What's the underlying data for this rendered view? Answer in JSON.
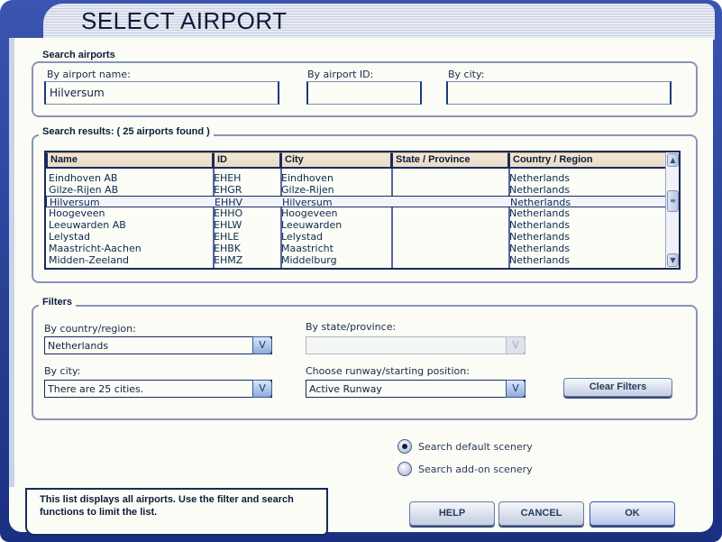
{
  "title": "SELECT AIRPORT",
  "search": {
    "group_label": "Search airports",
    "name_label": "By airport name:",
    "name_value": "Hilversum",
    "id_label": "By airport ID:",
    "id_value": "",
    "city_label": "By city:",
    "city_value": ""
  },
  "results": {
    "group_label": "Search results: ( 25 airports found )",
    "columns": [
      "Name",
      "ID",
      "City",
      "State / Province",
      "Country / Region"
    ],
    "rows": [
      {
        "name": "Eindhoven AB",
        "id": "EHEH",
        "city": "Eindhoven",
        "state": "",
        "country": "Netherlands"
      },
      {
        "name": "Gilze-Rijen AB",
        "id": "EHGR",
        "city": "Gilze-Rijen",
        "state": "",
        "country": "Netherlands"
      },
      {
        "name": "Hilversum",
        "id": "EHHV",
        "city": "Hilversum",
        "state": "",
        "country": "Netherlands",
        "selected": true
      },
      {
        "name": "Hoogeveen",
        "id": "EHHO",
        "city": "Hoogeveen",
        "state": "",
        "country": "Netherlands"
      },
      {
        "name": "Leeuwarden AB",
        "id": "EHLW",
        "city": "Leeuwarden",
        "state": "",
        "country": "Netherlands"
      },
      {
        "name": "Lelystad",
        "id": "EHLE",
        "city": "Lelystad",
        "state": "",
        "country": "Netherlands"
      },
      {
        "name": "Maastricht-Aachen",
        "id": "EHBK",
        "city": "Maastricht",
        "state": "",
        "country": "Netherlands"
      },
      {
        "name": "Midden-Zeeland",
        "id": "EHMZ",
        "city": "Middelburg",
        "state": "",
        "country": "Netherlands"
      }
    ]
  },
  "filters": {
    "group_label": "Filters",
    "country_label": "By country/region:",
    "country_value": "Netherlands",
    "state_label": "By state/province:",
    "state_value": "",
    "city_label": "By city:",
    "city_value": "There are 25 cities.",
    "runway_label": "Choose runway/starting position:",
    "runway_value": "Active Runway",
    "clear_label": "Clear Filters"
  },
  "scenery": {
    "default_label": "Search default scenery",
    "addon_label": "Search add-on scenery",
    "selected": "default"
  },
  "tip": "This list displays all airports. Use the filter and search functions to limit the list.",
  "buttons": {
    "help": "HELP",
    "cancel": "CANCEL",
    "ok": "OK"
  }
}
